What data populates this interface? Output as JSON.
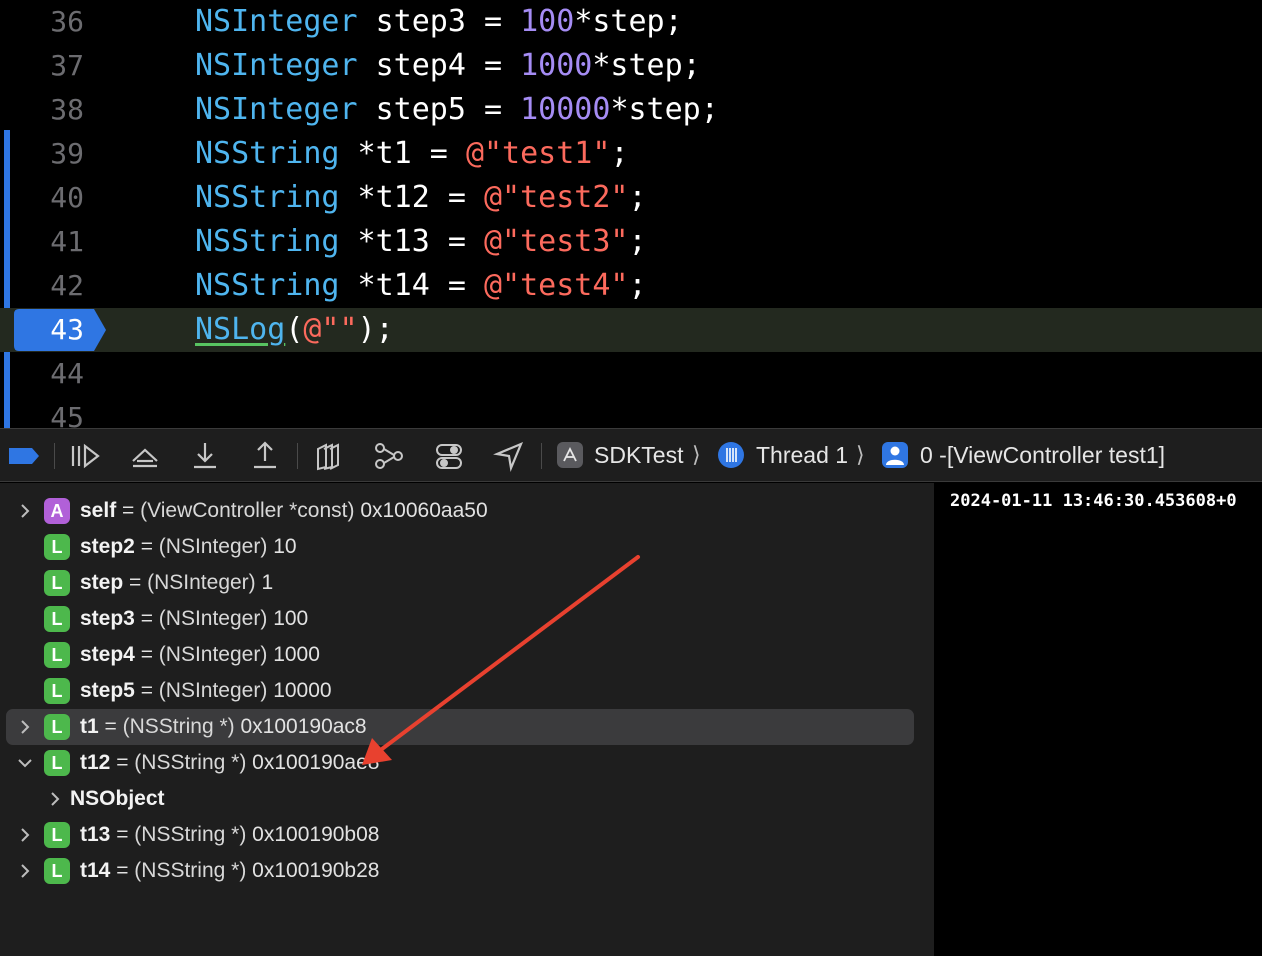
{
  "editor": {
    "lines": [
      {
        "num": "36",
        "tokens": [
          {
            "t": "type",
            "v": "NSInteger"
          },
          {
            "t": "plain",
            "v": " step3 = "
          },
          {
            "t": "num",
            "v": "100"
          },
          {
            "t": "plain",
            "v": "*step;"
          }
        ]
      },
      {
        "num": "37",
        "tokens": [
          {
            "t": "type",
            "v": "NSInteger"
          },
          {
            "t": "plain",
            "v": " step4 = "
          },
          {
            "t": "num",
            "v": "1000"
          },
          {
            "t": "plain",
            "v": "*step;"
          }
        ]
      },
      {
        "num": "38",
        "tokens": [
          {
            "t": "type",
            "v": "NSInteger"
          },
          {
            "t": "plain",
            "v": " step5 = "
          },
          {
            "t": "num",
            "v": "10000"
          },
          {
            "t": "plain",
            "v": "*step;"
          }
        ]
      },
      {
        "num": "39",
        "tokens": [
          {
            "t": "type",
            "v": "NSString"
          },
          {
            "t": "plain",
            "v": " *t1 = "
          },
          {
            "t": "str",
            "v": "@\"test1\""
          },
          {
            "t": "plain",
            "v": ";"
          }
        ]
      },
      {
        "num": "40",
        "tokens": [
          {
            "t": "type",
            "v": "NSString"
          },
          {
            "t": "plain",
            "v": " *t12 = "
          },
          {
            "t": "str",
            "v": "@\"test2\""
          },
          {
            "t": "plain",
            "v": ";"
          }
        ]
      },
      {
        "num": "41",
        "tokens": [
          {
            "t": "type",
            "v": "NSString"
          },
          {
            "t": "plain",
            "v": " *t13 = "
          },
          {
            "t": "str",
            "v": "@\"test3\""
          },
          {
            "t": "plain",
            "v": ";"
          }
        ]
      },
      {
        "num": "42",
        "tokens": [
          {
            "t": "type",
            "v": "NSString"
          },
          {
            "t": "plain",
            "v": " *t14 = "
          },
          {
            "t": "str",
            "v": "@\"test4\""
          },
          {
            "t": "plain",
            "v": ";"
          }
        ]
      },
      {
        "num": "43",
        "current": true,
        "tokens": [
          {
            "t": "fn",
            "v": "NSLog"
          },
          {
            "t": "plain",
            "v": "("
          },
          {
            "t": "str",
            "v": "@\"\""
          },
          {
            "t": "plain",
            "v": ");"
          }
        ]
      },
      {
        "num": "44",
        "tokens": []
      },
      {
        "num": "45",
        "tokens": []
      }
    ]
  },
  "toolbar": {
    "buttons": [
      {
        "name": "breakpoints-toggle-icon"
      },
      {
        "name": "continue-icon"
      },
      {
        "name": "step-over-icon"
      },
      {
        "name": "step-into-icon"
      },
      {
        "name": "step-out-icon"
      },
      {
        "name": "view-hierarchy-icon"
      },
      {
        "name": "memory-graph-icon"
      },
      {
        "name": "environment-overrides-icon"
      },
      {
        "name": "simulate-location-icon"
      }
    ],
    "breadcrumb": {
      "app": "SDKTest",
      "thread": "Thread 1",
      "frame": "0 -[ViewController test1]"
    }
  },
  "variables": [
    {
      "kind": "A",
      "name": "self",
      "type": "(ViewController *const)",
      "value": "0x10060aa50",
      "disclosure": "collapsed",
      "indent": 0
    },
    {
      "kind": "L",
      "name": "step2",
      "type": "(NSInteger)",
      "value": "10",
      "disclosure": "none",
      "indent": 0
    },
    {
      "kind": "L",
      "name": "step",
      "type": "(NSInteger)",
      "value": "1",
      "disclosure": "none",
      "indent": 0
    },
    {
      "kind": "L",
      "name": "step3",
      "type": "(NSInteger)",
      "value": "100",
      "disclosure": "none",
      "indent": 0
    },
    {
      "kind": "L",
      "name": "step4",
      "type": "(NSInteger)",
      "value": "1000",
      "disclosure": "none",
      "indent": 0
    },
    {
      "kind": "L",
      "name": "step5",
      "type": "(NSInteger)",
      "value": "10000",
      "disclosure": "none",
      "indent": 0
    },
    {
      "kind": "L",
      "name": "t1",
      "type": "(NSString *)",
      "value": "0x100190ac8",
      "disclosure": "collapsed",
      "indent": 0,
      "selected": true
    },
    {
      "kind": "L",
      "name": "t12",
      "type": "(NSString *)",
      "value": "0x100190ae8",
      "disclosure": "expanded",
      "indent": 0
    },
    {
      "kind": "",
      "name": "NSObject",
      "type": "",
      "value": "",
      "disclosure": "collapsed",
      "indent": 1
    },
    {
      "kind": "L",
      "name": "t13",
      "type": "(NSString *)",
      "value": "0x100190b08",
      "disclosure": "collapsed",
      "indent": 0
    },
    {
      "kind": "L",
      "name": "t14",
      "type": "(NSString *)",
      "value": "0x100190b28",
      "disclosure": "collapsed",
      "indent": 0
    }
  ],
  "console": {
    "text": "2024-01-11 13:46:30.453608+0"
  },
  "colors": {
    "annotation_arrow": "#e8412f",
    "breakpoint": "#2f76e3",
    "current_line": "#23291f"
  }
}
